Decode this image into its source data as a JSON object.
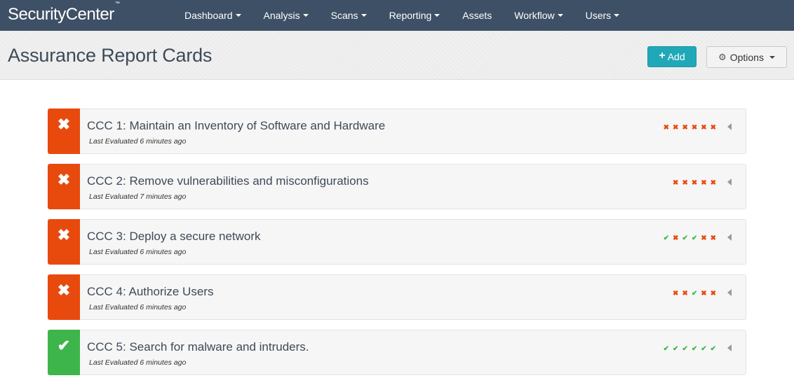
{
  "app": {
    "brand": "SecurityCenter",
    "brand_mark": "™"
  },
  "nav": {
    "items": [
      {
        "label": "Dashboard",
        "dropdown": true
      },
      {
        "label": "Analysis",
        "dropdown": true
      },
      {
        "label": "Scans",
        "dropdown": true
      },
      {
        "label": "Reporting",
        "dropdown": true
      },
      {
        "label": "Assets",
        "dropdown": false
      },
      {
        "label": "Workflow",
        "dropdown": true
      },
      {
        "label": "Users",
        "dropdown": true
      }
    ]
  },
  "header": {
    "title": "Assurance Report Cards",
    "add_label": "Add",
    "add_icon": "+",
    "options_label": "Options",
    "options_icon": "⚙"
  },
  "colors": {
    "nav_bg": "#3e5065",
    "fail": "#e84a0e",
    "pass": "#3db54a",
    "accent": "#20a8b8"
  },
  "cards": [
    {
      "status": "fail",
      "status_icon": "✖",
      "title": "CCC 1: Maintain an Inventory of Software and Hardware",
      "subtitle": "Last Evaluated 6 minutes ago",
      "results": [
        "fail",
        "fail",
        "fail",
        "fail",
        "fail",
        "fail"
      ]
    },
    {
      "status": "fail",
      "status_icon": "✖",
      "title": "CCC 2: Remove vulnerabilities and misconfigurations",
      "subtitle": "Last Evaluated 7 minutes ago",
      "results": [
        "fail",
        "fail",
        "fail",
        "fail",
        "fail"
      ]
    },
    {
      "status": "fail",
      "status_icon": "✖",
      "title": "CCC 3: Deploy a secure network",
      "subtitle": "Last Evaluated 6 minutes ago",
      "results": [
        "pass",
        "fail",
        "pass",
        "pass",
        "fail",
        "fail"
      ]
    },
    {
      "status": "fail",
      "status_icon": "✖",
      "title": "CCC 4: Authorize Users",
      "subtitle": "Last Evaluated 6 minutes ago",
      "results": [
        "fail",
        "fail",
        "pass",
        "fail",
        "fail"
      ]
    },
    {
      "status": "pass",
      "status_icon": "✔",
      "title": "CCC 5: Search for malware and intruders.",
      "subtitle": "Last Evaluated 6 minutes ago",
      "results": [
        "pass",
        "pass",
        "pass",
        "pass",
        "pass",
        "pass"
      ]
    }
  ]
}
